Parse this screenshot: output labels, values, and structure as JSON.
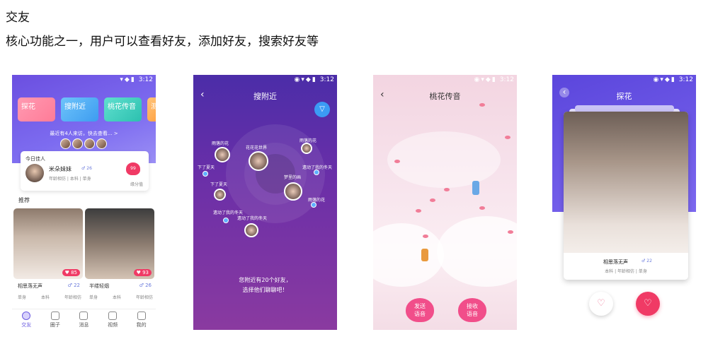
{
  "header": {
    "title": "交友",
    "subtitle": "核心功能之一，用户可以查看好友，添加好友，搜索好友等"
  },
  "status": {
    "time": "3:12"
  },
  "screen1": {
    "cards": [
      {
        "label": "探花",
        "color": "#ff8aa6"
      },
      {
        "label": "搜附近",
        "color": "#56b6f5"
      },
      {
        "label": "桃花传音",
        "color": "#47d1c2"
      },
      {
        "label": "测",
        "color": "#ffb15e"
      }
    ],
    "visitors_text": "最近有4人来访，快去查看... >",
    "today_title": "今日佳人",
    "today_name": "米朵妹妹",
    "today_likes": "26",
    "today_tags": "年龄相仿 | 本科 | 单身",
    "today_score": "99",
    "today_score_label": "缘分值",
    "recommend_label": "推荐",
    "photos": [
      {
        "score": "85",
        "name": "相思落无声",
        "likes": "22",
        "tags": [
          "单身",
          "本科",
          "年龄相仿"
        ]
      },
      {
        "score": "93",
        "name": "半缕轻烟",
        "likes": "26",
        "tags": [
          "单身",
          "本科",
          "年龄相仿"
        ]
      }
    ],
    "tabs": [
      "交友",
      "圈子",
      "消息",
      "视频",
      "我的"
    ]
  },
  "screen2": {
    "title": "搜附近",
    "users": [
      "雨落的花",
      "花花花世界",
      "雨落的花",
      "下了夏天",
      "遗动了我的冬天",
      "梦里的画",
      "下了夏天",
      "遗动了我的冬天",
      "雨落的花",
      "遗动了我的冬天"
    ],
    "nearby_text_1": "您附近有20个好友，",
    "nearby_text_2": "选择他们聊聊吧！"
  },
  "screen3": {
    "title": "桃花传音",
    "send_label_1": "发送",
    "send_label_2": "语音",
    "recv_label_1": "接收",
    "recv_label_2": "语音"
  },
  "screen4": {
    "title": "探花",
    "name": "相思落无声",
    "likes": "22",
    "tags": "本科 | 年龄相仿 | 单身",
    "unlike_icon": "broken-heart-icon",
    "like_icon": "heart-icon"
  }
}
